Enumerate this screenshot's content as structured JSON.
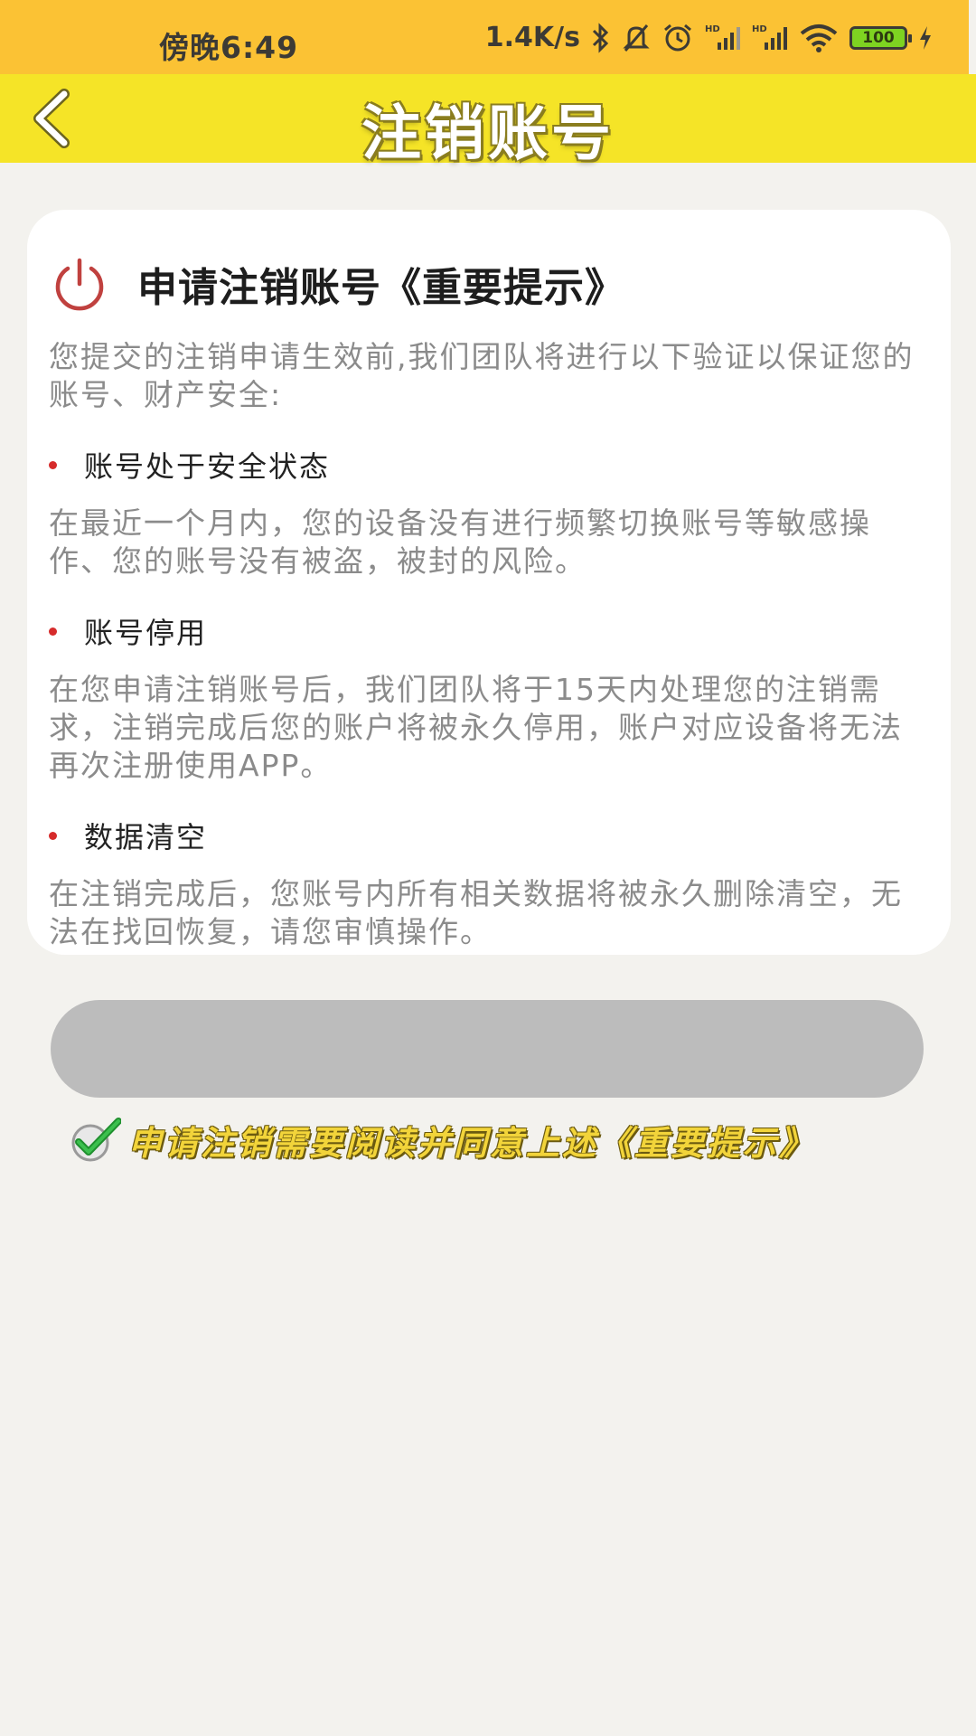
{
  "status_bar": {
    "time": "傍晚6:49",
    "speed": "1.4K/s",
    "battery": "100",
    "icons": [
      "bluetooth-icon",
      "mute-bell-icon",
      "alarm-icon",
      "signal-hd-icon",
      "signal-hd-icon",
      "wifi-icon",
      "battery-icon",
      "charging-icon"
    ],
    "color": "#fbc234"
  },
  "nav": {
    "title": "注销账号",
    "back_icon": "chevron-left-icon",
    "color": "#f5e427"
  },
  "card": {
    "title": "申请注销账号《重要提示》",
    "title_icon": "power-icon",
    "intro": "您提交的注销申请生效前,我们团队将进行以下验证以保证您的账号、财产安全:",
    "sections": [
      {
        "title": "账号处于安全状态",
        "body": "在最近一个月内，您的设备没有进行频繁切换账号等敏感操作、您的账号没有被盗，被封的风险。"
      },
      {
        "title": "账号停用",
        "body": "在您申请注销账号后，我们团队将于15天内处理您的注销需求，注销完成后您的账户将被永久停用，账户对应设备将无法再次注册使用APP。"
      },
      {
        "title": "数据清空",
        "body": "在注销完成后，您账号内所有相关数据将被永久删除清空，无法在找回恢复，请您审慎操作。"
      }
    ]
  },
  "submit": {
    "label": "",
    "color": "#bcbcbc"
  },
  "agreement": {
    "checked": true,
    "text": "申请注销需要阅读并同意上述《重要提示》"
  }
}
